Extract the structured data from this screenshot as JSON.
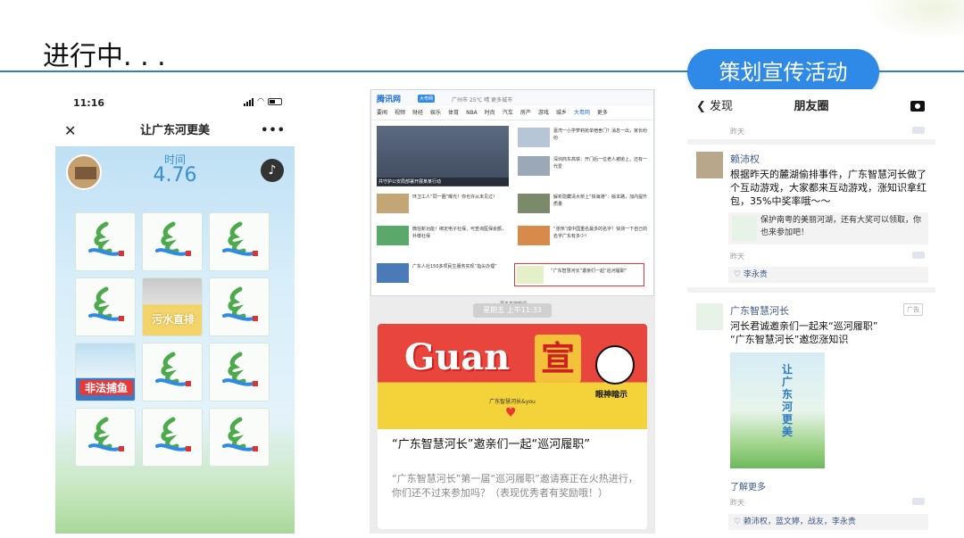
{
  "slide": {
    "title": "进行中. . .",
    "badge": "策划宣传活动",
    "accent": "#2e8ae6"
  },
  "phone1": {
    "status_time": "11:16",
    "nav_title": "让广东河更美",
    "close_icon": "close-icon",
    "more_icon": "more-dots-icon",
    "timer_label": "时间",
    "timer_value": "4.76",
    "cards": [
      "logo",
      "logo",
      "logo",
      "logo",
      "污水直排",
      "logo",
      "非法捕鱼",
      "logo",
      "logo",
      "logo",
      "logo",
      "logo"
    ]
  },
  "phone2": {
    "news": {
      "logo": "腾讯网",
      "badge": "大粤网",
      "weather": "广州市  25℃  晴  更多城市",
      "tabs": [
        "要闻",
        "视频",
        "财经",
        "娱乐",
        "体育",
        "NBA",
        "时尚",
        "汽车",
        "房产",
        "游戏",
        "城乡",
        "大粤网",
        "更多"
      ],
      "hero_caption": "共守护公安局部署开展某某行动",
      "items": [
        "嘉湾一小学萝莉抢单宿舍门？消息一出，家长纷纷",
        "深圳商东高铁：开门后一位老人被抛上，还有一代爱",
        "环卫工人“同一圈”曝光！你也许从未见过！",
        "解析隐藏清大桥上“铁海港”：版本路，加内提升质量",
        "微信新功能！绑定电子社保，可查询医保余额，补缴社保",
        "“张伟”成中国重名最多的名字！快测一下自己的名字广东有多少！",
        "广东人社150多项民生服务实现“指尖办理”",
        "“广东智慧河长”邀亲们一起“巡河履职”"
      ],
      "more": "更多本地新闻"
    },
    "chat_time": "星期五 上午11:33",
    "banner_word": "Guan",
    "banner_char": "宣",
    "banner_tag": "眼神暗示",
    "banner_sub": "广东智慧河长&you",
    "msg_title": "“广东智慧河长”邀亲们一起“巡河履职”",
    "msg_desc": "“广东智慧河长”第一届“巡河履职”邀请赛正在火热进行，你们还不过来参加吗？（表现优秀者有奖励哦！）"
  },
  "phone3": {
    "back_label": "发现",
    "nav_title": "朋友圈",
    "camera_icon": "camera-icon",
    "top_time": "昨天",
    "post1": {
      "name": "赖沛权",
      "text": "根据昨天的麓湖偷排事件，广东智慧河长做了个互动游戏，大家都来互动游戏，涨知识拿红包，35%中奖率哦～～",
      "link_text": "保护南粤的美丽河湖，还有大奖可以领取，你也来参加吧！",
      "time": "昨天",
      "likes": "♡ 李永贵"
    },
    "post2": {
      "name": "广东智慧河长",
      "ad_label": "广告",
      "text": "河长君诚邀亲们一起来“巡河履职”\n“广东智慧河长”邀您涨知识",
      "poster_text": "让广东河更美",
      "learn_more": "了解更多",
      "time": "昨天",
      "likes": "♡ 赖沛权，蓝文婷，战友，李永贵"
    }
  }
}
